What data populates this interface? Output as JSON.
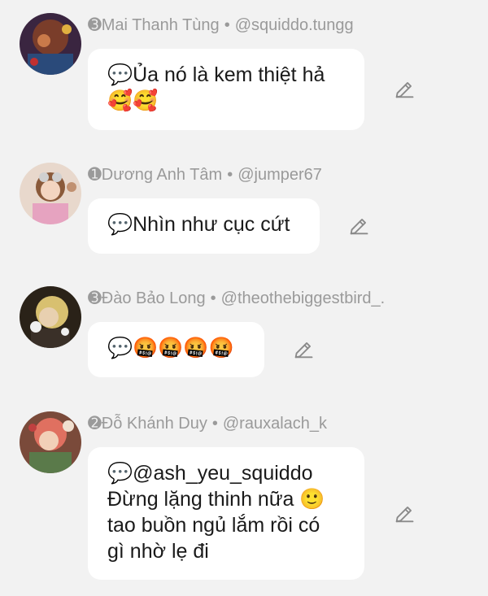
{
  "comments": [
    {
      "badge": "➌",
      "name": "Mai Thanh Tùng",
      "separator": "•",
      "handle": "@squiddo.tungg",
      "lines": [
        "💬Ủa nó là kem thiệt hả",
        "🥰🥰"
      ]
    },
    {
      "badge": "➊",
      "name": "Dương Anh Tâm",
      "separator": "•",
      "handle": "@jumper67",
      "lines": [
        "💬Nhìn như cục cứt"
      ]
    },
    {
      "badge": "➌",
      "name": "Đào Bảo Long",
      "separator": "•",
      "handle": "@theothebiggestbird_.",
      "lines": [
        "💬🤬🤬🤬🤬"
      ]
    },
    {
      "badge": "➋",
      "name": "Đỗ Khánh Duy",
      "separator": "•",
      "handle": "@rauxalach_k",
      "lines": [
        "💬@ash_yeu_squiddo",
        "Đừng lặng thinh nữa 🙂",
        "tao buồn ngủ lắm rồi có",
        "gì nhờ lẹ đi"
      ]
    }
  ],
  "icons": {
    "edit": "pencil-icon",
    "avatar": "avatar-image"
  },
  "colors": {
    "background": "#f2f2f2",
    "bubble": "#ffffff",
    "meta_text": "#9a9a9a",
    "body_text": "#1a1a1a",
    "icon": "#8a8a8a"
  }
}
